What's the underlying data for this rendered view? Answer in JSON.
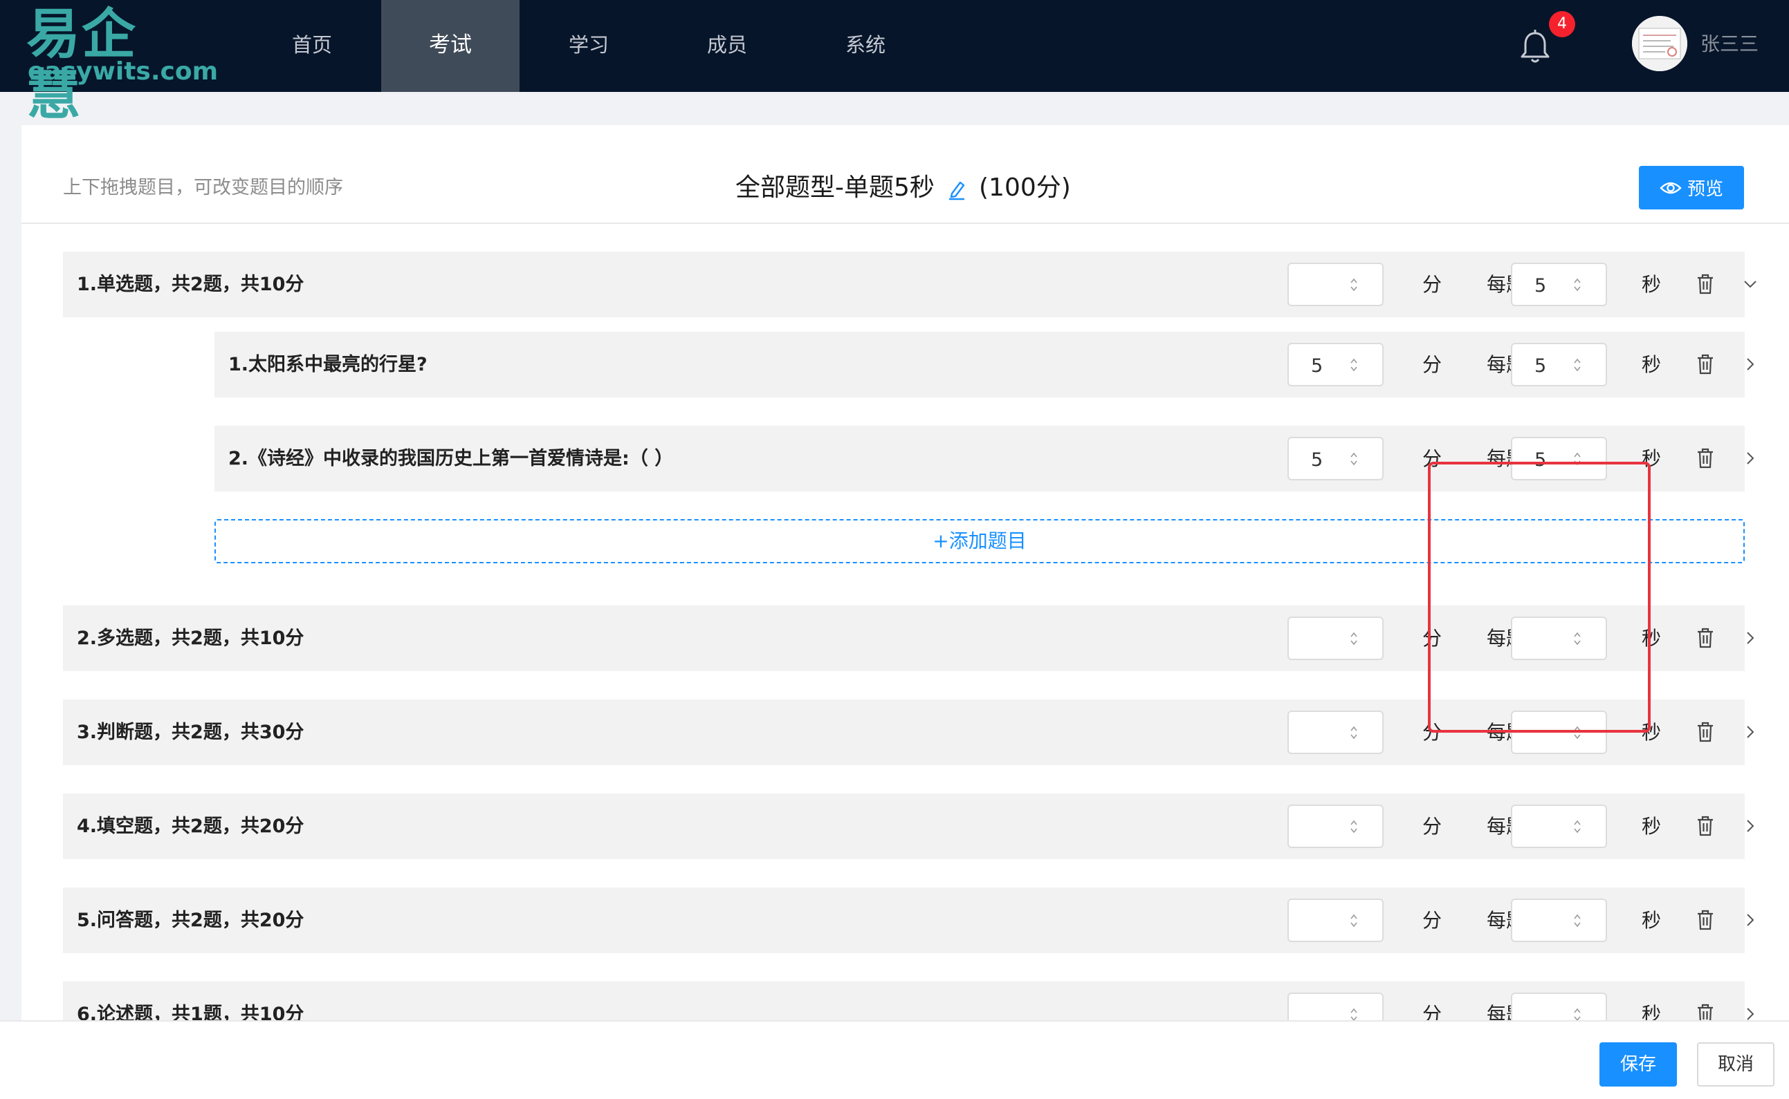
{
  "brand": {
    "logo_cn": "易企慧",
    "logo_en": "easywits.com"
  },
  "nav": {
    "items": [
      {
        "label": "首页"
      },
      {
        "label": "考试"
      },
      {
        "label": "学习"
      },
      {
        "label": "成员"
      },
      {
        "label": "系统"
      }
    ],
    "active": "考试"
  },
  "header": {
    "notification_count": "4",
    "user_name": "张三三"
  },
  "editor": {
    "hint": "上下拖拽题目，可改变题目的顺序",
    "title": "全部题型-单题5秒",
    "total_score": "(100分)",
    "preview_label": "预览"
  },
  "units": {
    "score": "分",
    "per_question": "每题",
    "seconds": "秒"
  },
  "sections": [
    {
      "label": "1.单选题，共2题，共10分",
      "score": "",
      "seconds": "5",
      "expanded": true,
      "questions": [
        {
          "label": "1.太阳系中最亮的行星?",
          "score": "5",
          "seconds": "5"
        },
        {
          "label": "2.《诗经》中收录的我国历史上第一首爱情诗是:（ ）",
          "score": "5",
          "seconds": "5"
        }
      ],
      "add_label": "+添加题目"
    },
    {
      "label": "2.多选题，共2题，共10分",
      "score": "",
      "seconds": ""
    },
    {
      "label": "3.判断题，共2题，共30分",
      "score": "",
      "seconds": ""
    },
    {
      "label": "4.填空题，共2题，共20分",
      "score": "",
      "seconds": ""
    },
    {
      "label": "5.问答题，共2题，共20分",
      "score": "",
      "seconds": ""
    },
    {
      "label": "6.论述题，共1题，共10分",
      "score": "",
      "seconds": ""
    }
  ],
  "footer": {
    "save_label": "保存",
    "cancel_label": "取消"
  },
  "colors": {
    "primary": "#1890ff",
    "nav_bg": "#06152a",
    "nav_active_bg": "#404b59",
    "logo": "#3aa9a6",
    "badge": "#f5222d",
    "highlight": "#e8333f",
    "row_bg": "#f2f2f2"
  },
  "icons": [
    "bell-icon",
    "edit-icon",
    "eye-icon",
    "trash-icon",
    "chevron-down-icon",
    "chevron-right-icon",
    "spinner-icon"
  ]
}
